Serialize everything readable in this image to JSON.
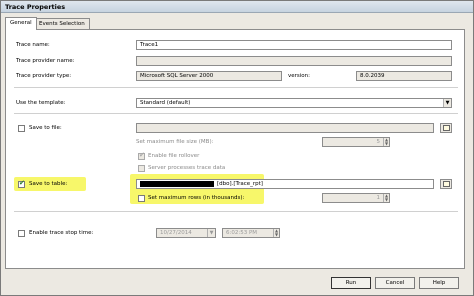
{
  "window": {
    "title": "Trace Properties"
  },
  "tabs": [
    {
      "label": "General",
      "active": true
    },
    {
      "label": "Events Selection",
      "active": false
    }
  ],
  "general": {
    "trace_name_label": "Trace name:",
    "trace_name_value": "Trace1",
    "provider_name_label": "Trace provider name:",
    "provider_type_label": "Trace provider type:",
    "provider_type_value": "Microsoft SQL Server 2000",
    "version_label": "version:",
    "version_value": "8.0.2039",
    "template_label": "Use the template:",
    "template_value": "Standard (default)",
    "save_to_file_label": "Save to file:",
    "save_to_file_checked": false,
    "max_file_size_label": "Set maximum file size (MB):",
    "max_file_size_value": "5",
    "file_rollover_label": "Enable file rollover",
    "server_processes_label": "Server processes trace data",
    "save_to_table_label": "Save to table:",
    "save_to_table_checked": true,
    "table_value": "[dbo].[Trace_rpt]",
    "max_rows_label": "Set maximum rows (in thousands):",
    "max_rows_value": "1",
    "stop_time_label": "Enable trace stop time:",
    "stop_date_value": "10/27/2014",
    "stop_time_value": "6:02:53 PM"
  },
  "footer": {
    "run_label": "Run",
    "cancel_label": "Cancel",
    "help_label": "Help"
  },
  "colors": {
    "highlight": "#f6f65a",
    "check_mark": "#2a7a2a"
  }
}
